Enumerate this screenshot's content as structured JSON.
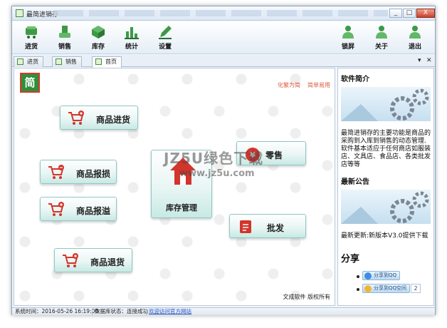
{
  "window": {
    "title": "最简进销存",
    "controls": [
      "_",
      "□",
      "X"
    ]
  },
  "toolbar": {
    "left": [
      {
        "label": "进货",
        "icon": "cart-icon"
      },
      {
        "label": "销售",
        "icon": "sell-icon"
      },
      {
        "label": "库存",
        "icon": "inventory-box-icon"
      },
      {
        "label": "统计",
        "icon": "bar-chart-icon"
      },
      {
        "label": "设置",
        "icon": "pencil-settings-icon"
      }
    ],
    "right": [
      {
        "label": "锁屏",
        "icon": "lock-user-icon"
      },
      {
        "label": "关于",
        "icon": "about-user-icon"
      },
      {
        "label": "退出",
        "icon": "exit-user-icon"
      }
    ]
  },
  "tabs": [
    {
      "label": "进货",
      "active": false
    },
    {
      "label": "销售",
      "active": false
    },
    {
      "label": "首页",
      "active": true
    }
  ],
  "tab_controls": {
    "menu": "▾",
    "close": "✕"
  },
  "home": {
    "logo_char": "简",
    "links": {
      "traditional": "化繁为简",
      "easy": "简单易用"
    },
    "buttons": {
      "purchase": "商品进货",
      "sale": "零售",
      "loss": "商品报损",
      "overflow": "商品报溢",
      "stock": "库存管理",
      "wholesale": "批发",
      "return": "商品退货"
    },
    "watermark": "JZ5U绿色下载",
    "watermark_url": "www.jz5u.com",
    "copyright": "文成软件  版权所有"
  },
  "sidebar": {
    "intro_title": "软件简介",
    "intro_text": "最简进销存的主要功能是商品的采购到入库到销售的动态管理.软件基本适应于任何商店如服装店、文具店、食品店、各类批发店等等",
    "news_title": "最新公告",
    "news_text": "最新更新:新版本V3.0提供下载",
    "share_title": "分享",
    "share_buttons": [
      {
        "label": "分享到QQ"
      },
      {
        "label": "分享到QQ空间",
        "count": "2"
      }
    ]
  },
  "status": {
    "time_label": "系统时间：2016-05-26 16:19:00",
    "db_label": "数据库状态：连接成功",
    "site_link": "欢迎访问官方网站"
  },
  "colors": {
    "accent": "#2f8f3a",
    "button_border": "#8ec9c4",
    "link": "#e05a3a",
    "status_link": "#1c4fc4"
  }
}
